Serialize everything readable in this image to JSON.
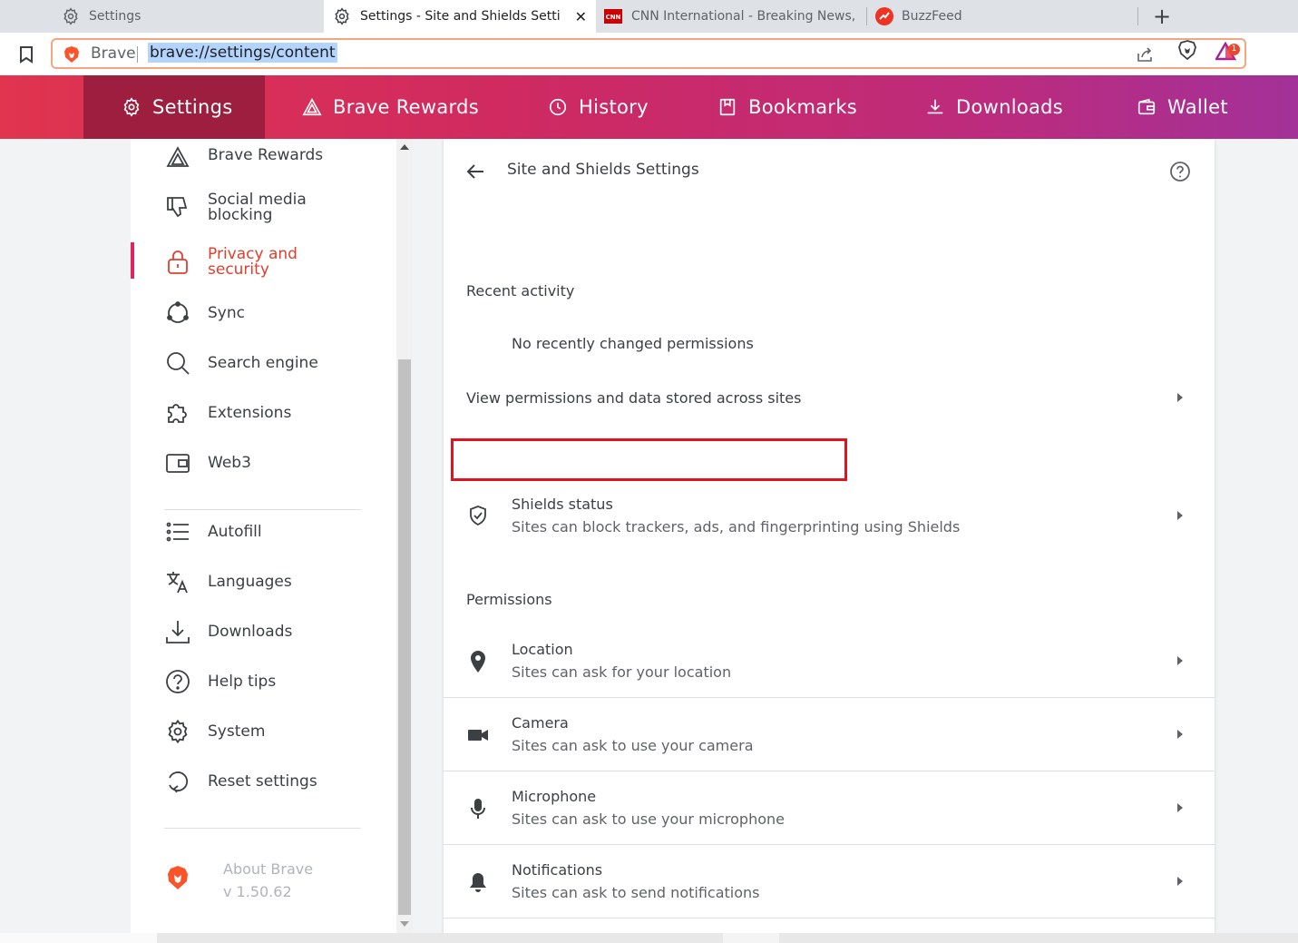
{
  "tabs": [
    {
      "title": "Settings",
      "icon": "gear-icon"
    },
    {
      "title": "Settings - Site and Shields Settings",
      "icon": "gear-icon",
      "active": true
    },
    {
      "title": "CNN International - Breaking News, US News, World News",
      "icon": "cnn-icon"
    },
    {
      "title": "BuzzFeed",
      "icon": "buzzfeed-icon"
    }
  ],
  "toolbar": {
    "brand_label": "Brave",
    "url": "brave://settings/content",
    "rewards_badge": "1"
  },
  "nav": {
    "items": [
      {
        "label": "Settings",
        "icon": "gear-icon"
      },
      {
        "label": "Brave Rewards",
        "icon": "triangle-icon"
      },
      {
        "label": "History",
        "icon": "history-icon"
      },
      {
        "label": "Bookmarks",
        "icon": "bookmark-icon"
      },
      {
        "label": "Downloads",
        "icon": "download-icon"
      },
      {
        "label": "Wallet",
        "icon": "wallet-icon"
      }
    ]
  },
  "sidebar": {
    "items": [
      {
        "label": "Brave Rewards"
      },
      {
        "label": "Social media\nblocking"
      },
      {
        "label": "Privacy and\nsecurity",
        "active": true
      },
      {
        "label": "Sync"
      },
      {
        "label": "Search engine"
      },
      {
        "label": "Extensions"
      },
      {
        "label": "Web3"
      },
      {
        "label": "Autofill"
      },
      {
        "label": "Languages"
      },
      {
        "label": "Downloads"
      },
      {
        "label": "Help tips"
      },
      {
        "label": "System"
      },
      {
        "label": "Reset settings"
      }
    ],
    "about_label": "About Brave",
    "version": "v 1.50.62"
  },
  "main": {
    "title": "Site and Shields Settings",
    "recent_heading": "Recent activity",
    "no_recent": "No recently changed permissions",
    "view_permissions": "View permissions and data stored across sites",
    "shields": {
      "title": "Shields status",
      "subtitle": "Sites can block trackers, ads, and fingerprinting using Shields"
    },
    "permissions_heading": "Permissions",
    "permissions": [
      {
        "title": "Location",
        "subtitle": "Sites can ask for your location",
        "icon": "location-pin-icon"
      },
      {
        "title": "Camera",
        "subtitle": "Sites can ask to use your camera",
        "icon": "camera-icon"
      },
      {
        "title": "Microphone",
        "subtitle": "Sites can ask to use your microphone",
        "icon": "microphone-icon"
      },
      {
        "title": "Notifications",
        "subtitle": "Sites can ask to send notifications",
        "icon": "bell-icon"
      }
    ]
  },
  "colors": {
    "accent": "#e03e2d",
    "highlight_box": "#e0141e",
    "nav_gradient_start": "#e0344f",
    "nav_gradient_end": "#a33198"
  }
}
